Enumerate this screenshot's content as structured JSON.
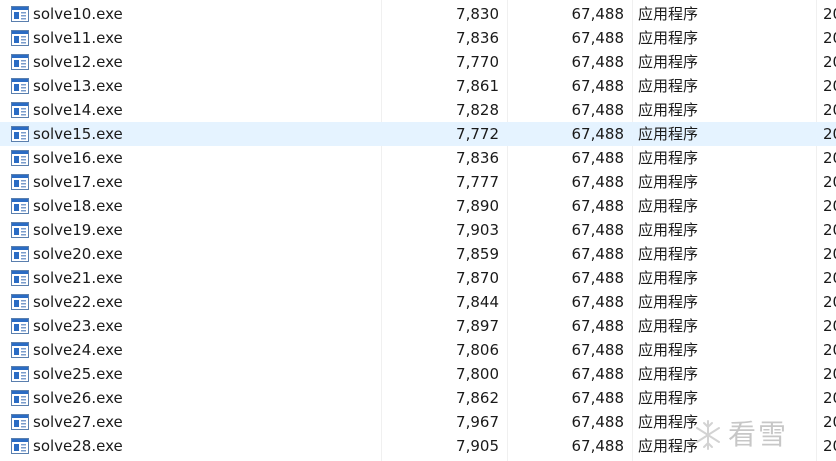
{
  "files": [
    {
      "name": "solve10.exe",
      "size1": "7,830",
      "size2": "67,488",
      "type": "应用程序",
      "date": "20"
    },
    {
      "name": "solve11.exe",
      "size1": "7,836",
      "size2": "67,488",
      "type": "应用程序",
      "date": "20"
    },
    {
      "name": "solve12.exe",
      "size1": "7,770",
      "size2": "67,488",
      "type": "应用程序",
      "date": "20"
    },
    {
      "name": "solve13.exe",
      "size1": "7,861",
      "size2": "67,488",
      "type": "应用程序",
      "date": "20"
    },
    {
      "name": "solve14.exe",
      "size1": "7,828",
      "size2": "67,488",
      "type": "应用程序",
      "date": "20"
    },
    {
      "name": "solve15.exe",
      "size1": "7,772",
      "size2": "67,488",
      "type": "应用程序",
      "date": "20"
    },
    {
      "name": "solve16.exe",
      "size1": "7,836",
      "size2": "67,488",
      "type": "应用程序",
      "date": "20"
    },
    {
      "name": "solve17.exe",
      "size1": "7,777",
      "size2": "67,488",
      "type": "应用程序",
      "date": "20"
    },
    {
      "name": "solve18.exe",
      "size1": "7,890",
      "size2": "67,488",
      "type": "应用程序",
      "date": "20"
    },
    {
      "name": "solve19.exe",
      "size1": "7,903",
      "size2": "67,488",
      "type": "应用程序",
      "date": "20"
    },
    {
      "name": "solve20.exe",
      "size1": "7,859",
      "size2": "67,488",
      "type": "应用程序",
      "date": "20"
    },
    {
      "name": "solve21.exe",
      "size1": "7,870",
      "size2": "67,488",
      "type": "应用程序",
      "date": "20"
    },
    {
      "name": "solve22.exe",
      "size1": "7,844",
      "size2": "67,488",
      "type": "应用程序",
      "date": "20"
    },
    {
      "name": "solve23.exe",
      "size1": "7,897",
      "size2": "67,488",
      "type": "应用程序",
      "date": "20"
    },
    {
      "name": "solve24.exe",
      "size1": "7,806",
      "size2": "67,488",
      "type": "应用程序",
      "date": "20"
    },
    {
      "name": "solve25.exe",
      "size1": "7,800",
      "size2": "67,488",
      "type": "应用程序",
      "date": "20"
    },
    {
      "name": "solve26.exe",
      "size1": "7,862",
      "size2": "67,488",
      "type": "应用程序",
      "date": "20"
    },
    {
      "name": "solve27.exe",
      "size1": "7,967",
      "size2": "67,488",
      "type": "应用程序",
      "date": "20"
    },
    {
      "name": "solve28.exe",
      "size1": "7,905",
      "size2": "67,488",
      "type": "应用程序",
      "date": "20"
    }
  ],
  "selected_file": "solve15.exe",
  "file_icon": "exe-application-icon",
  "colors": {
    "selected_row": "#e5f3ff",
    "text": "#1a1a1a",
    "column_divider": "#f0f0f0",
    "icon_blue": "#2b6cc4"
  },
  "watermark": {
    "text": "看雪",
    "icon": "snowflake-logo-icon"
  }
}
